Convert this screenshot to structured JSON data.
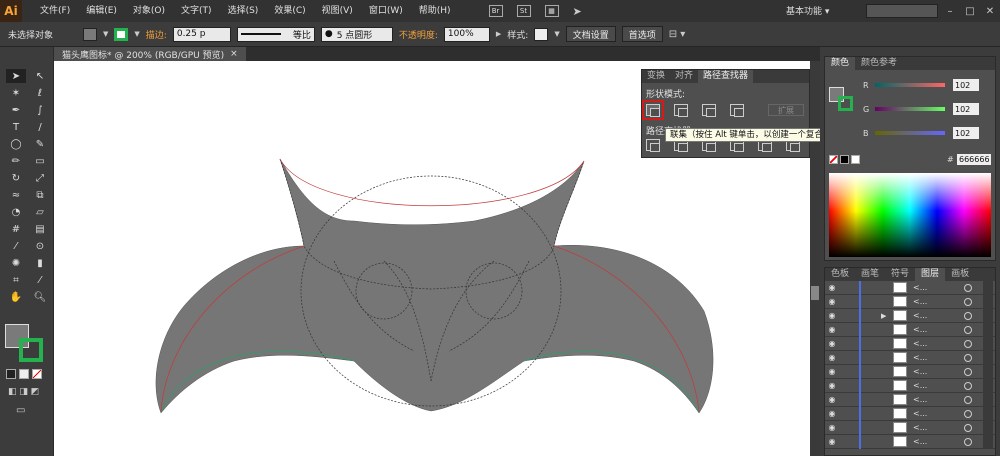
{
  "app": {
    "logo": "Ai"
  },
  "menu": [
    "文件(F)",
    "编辑(E)",
    "对象(O)",
    "文字(T)",
    "选择(S)",
    "效果(C)",
    "视图(V)",
    "窗口(W)",
    "帮助(H)"
  ],
  "menu_tools": {
    "br": "Br",
    "st": "St"
  },
  "workspace": {
    "label": "基本功能 ▾"
  },
  "control": {
    "selection_status": "未选择对象",
    "stroke_label": "描边:",
    "stroke_weight": "0.25 p",
    "stroke_profile": "等比",
    "brush": "5 点圆形",
    "opacity_label": "不透明度:",
    "opacity_value": "100%",
    "style_label": "样式:",
    "doc_setup": "文档设置",
    "preferences": "首选项"
  },
  "document": {
    "tab": "猫头鹰图标* @ 200% (RGB/GPU 预览)",
    "close": "×"
  },
  "pathfinder": {
    "tabs": [
      "变换",
      "对齐",
      "路径查找器"
    ],
    "shape_modes_label": "形状模式:",
    "pathfinders_label": "路径查找器:",
    "expand": "扩展",
    "tooltip": "联集（按住 Alt 键单击，以创建一个复合形状，并添加到形状区域）"
  },
  "color_panel": {
    "tabs": [
      "颜色",
      "颜色参考"
    ],
    "r_label": "R",
    "g_label": "G",
    "b_label": "B",
    "r": "102",
    "g": "102",
    "b": "102",
    "hex_sign": "#",
    "hex": "666666"
  },
  "layers_panel": {
    "tabs": [
      "色板",
      "画笔",
      "符号",
      "图层",
      "画板"
    ],
    "row_label": "<...",
    "rows": 12
  },
  "colors": {
    "fill": "#7a7a7a",
    "stroke": "#23b24d",
    "shape": "#767676"
  }
}
